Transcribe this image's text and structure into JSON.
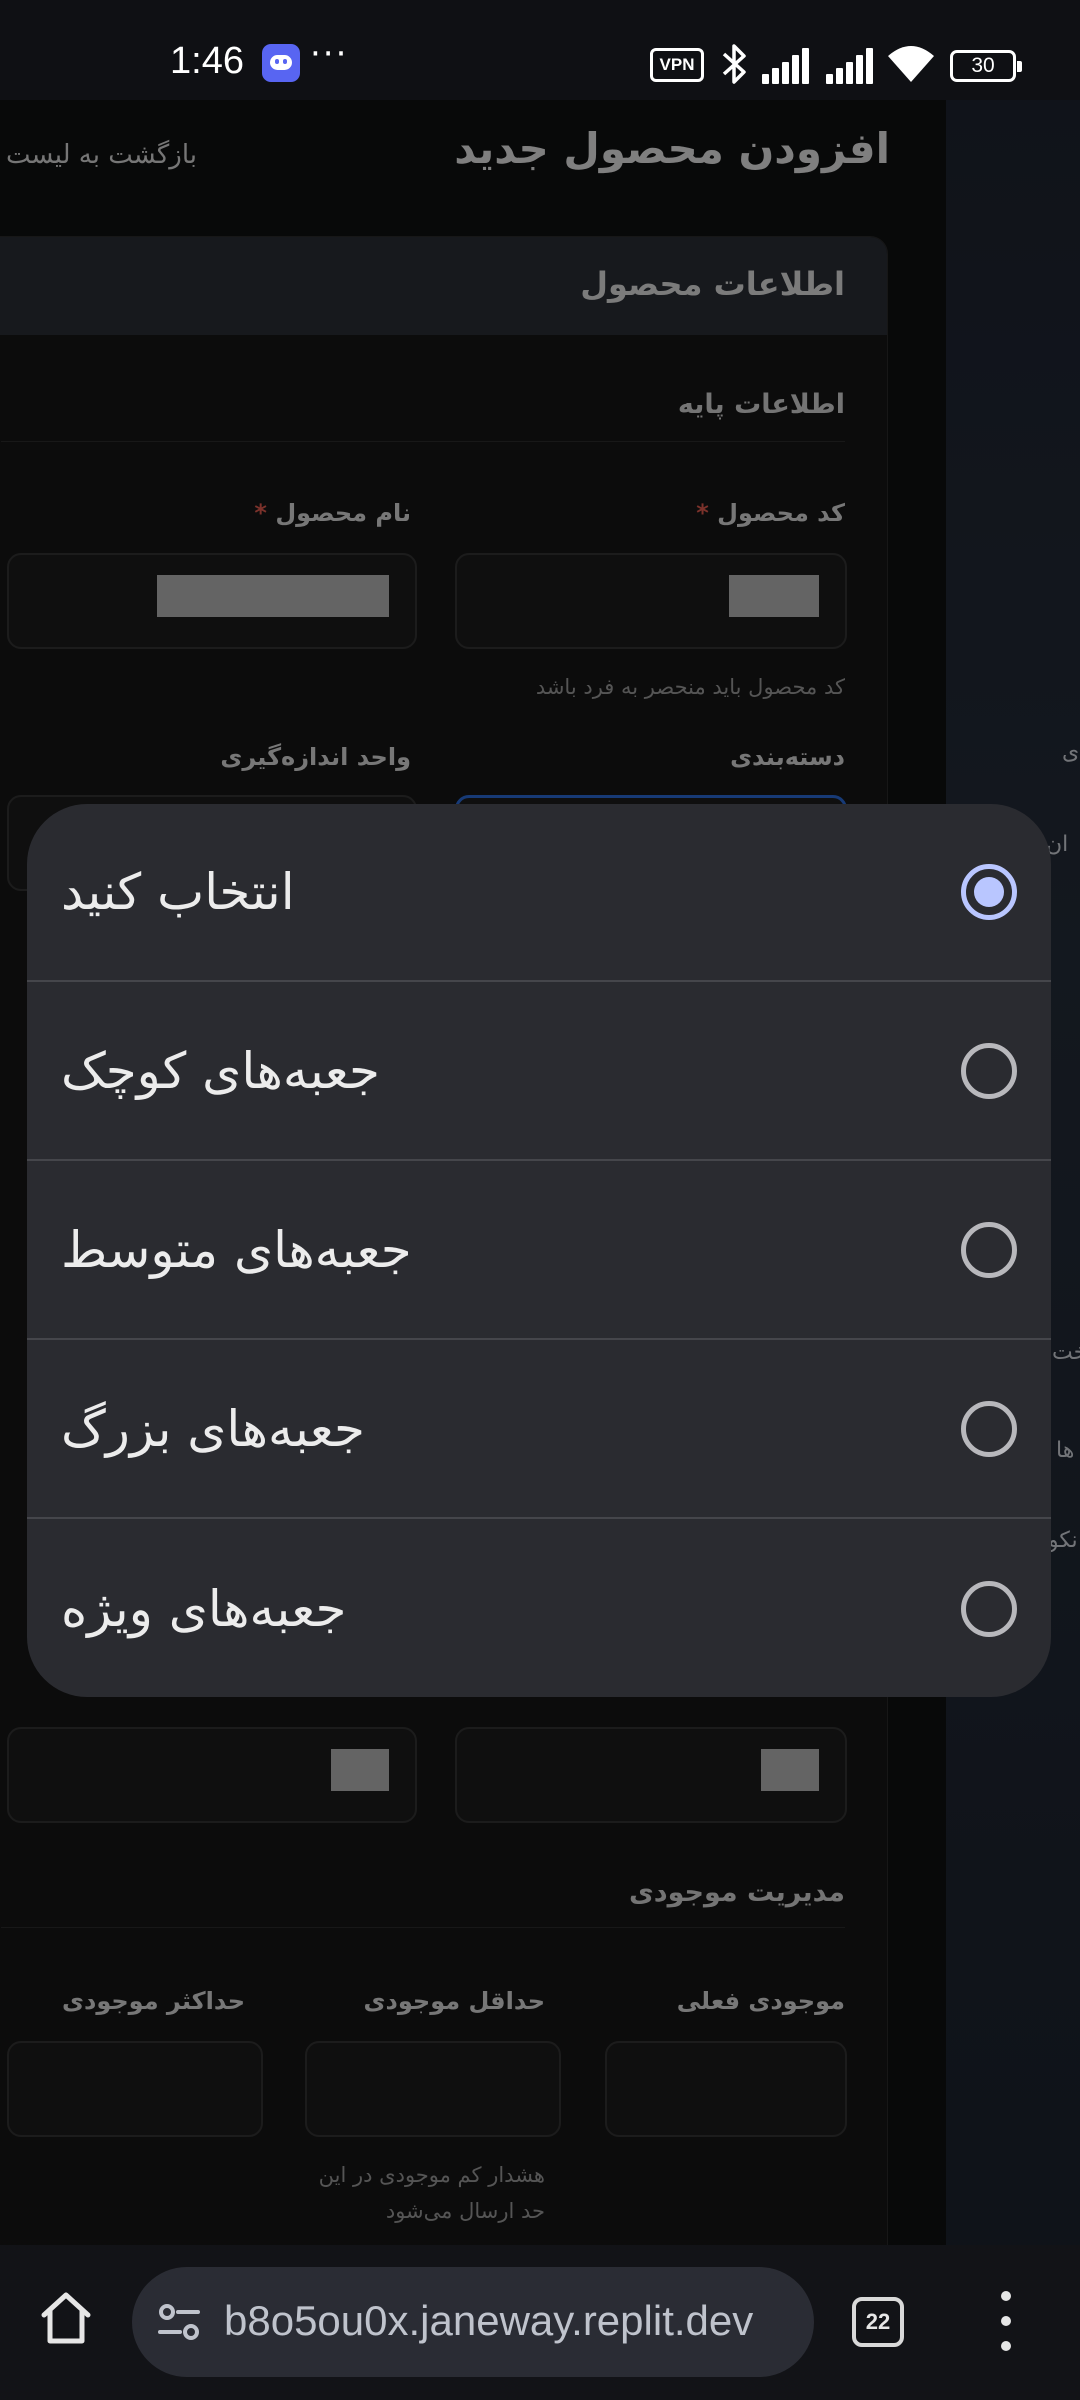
{
  "status_bar": {
    "time": "1:46",
    "more": "···",
    "vpn": "VPN",
    "battery": "30"
  },
  "page": {
    "title": "افزودن محصول جدید",
    "back_link": "بازگشت به لیست",
    "card_title": "اطلاعات محصول",
    "basic_info_title": "اطلاعات پایه",
    "product_code_label": "کد محصول",
    "product_name_label": "نام محصول",
    "required_mark": "*",
    "product_code_hint": "کد محصول باید منحصر به فرد باشد",
    "category_label": "دسته‌بندی",
    "unit_label": "واحد اندازه‌گیری",
    "inventory_title": "مدیریت موجودی",
    "current_stock_label": "موجودی فعلی",
    "min_stock_label": "حداقل موجودی",
    "max_stock_label": "حداکثر موجودی",
    "min_stock_hint_line1": "هشدار کم موجودی در این",
    "min_stock_hint_line2": "حد ارسال می‌شود"
  },
  "side_fragments": [
    "ی",
    "ان",
    "خت",
    "ها",
    "نکو"
  ],
  "picker": {
    "options": [
      {
        "label": "انتخاب کنید",
        "selected": true
      },
      {
        "label": "جعبه‌های کوچک",
        "selected": false
      },
      {
        "label": "جعبه‌های متوسط",
        "selected": false
      },
      {
        "label": "جعبه‌های بزرگ",
        "selected": false
      },
      {
        "label": "جعبه‌های ویژه",
        "selected": false
      }
    ]
  },
  "browser": {
    "url": "b8o5ou0x.janeway.replit.dev",
    "tab_count": "22"
  },
  "colors": {
    "accent_radio": "#b9c6ff",
    "required": "#e25b4f",
    "focus_border": "#2a6ad8"
  }
}
